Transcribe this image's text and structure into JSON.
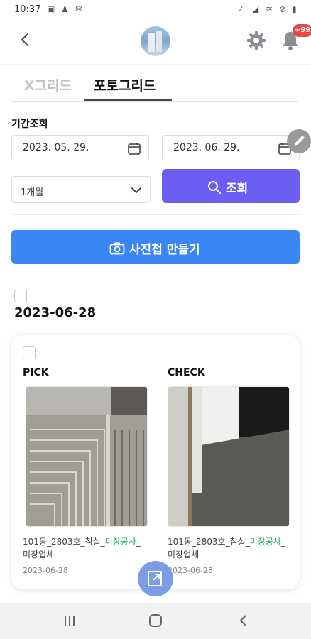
{
  "status_bar": {
    "time": "10:37"
  },
  "header": {
    "back_label": "<",
    "notification_badge": "+99"
  },
  "tabs": [
    {
      "label": "X그리드",
      "active": false
    },
    {
      "label": "포토그리드",
      "active": true
    }
  ],
  "filter": {
    "period_label": "기간조회",
    "start_date": "2023. 05. 29.",
    "end_date": "2023. 06. 29.",
    "range_option": "1개월",
    "search_label": "조회"
  },
  "make_album_label": "사진첩 만들기",
  "group": {
    "date": "2023-06-28",
    "items": [
      {
        "title": "PICK",
        "caption_main": "101동_2803호_침실_",
        "caption_highlight": "미장공사",
        "caption_tail": "_미장업체",
        "date": "2023-06-28"
      },
      {
        "title": "CHECK",
        "caption_main": "101동_2803호_침실_",
        "caption_highlight": "미장공사",
        "caption_tail": "_미장업체",
        "date": "2023-06-28"
      }
    ]
  },
  "colors": {
    "search_button": "#6b5ef2",
    "make_button": "#3a86f5",
    "highlight_text": "#1fb064",
    "badge": "#e84a4a"
  }
}
